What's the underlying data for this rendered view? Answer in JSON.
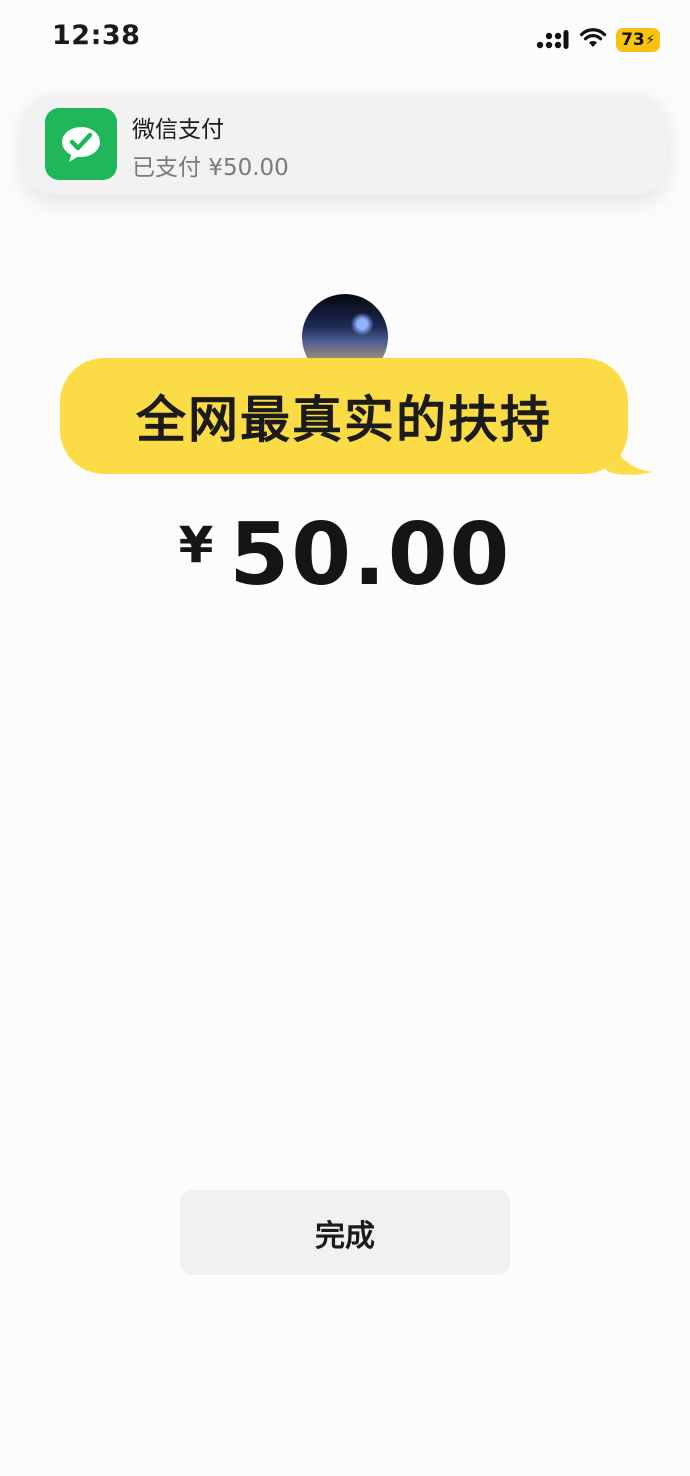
{
  "status_bar": {
    "time": "12:38",
    "battery_level": "73",
    "battery_color": "#f6c40f",
    "icons": [
      "signal-icon",
      "wifi-icon",
      "charging-bolt-icon"
    ]
  },
  "notification": {
    "app_name": "微信支付",
    "message": "已支付 ¥50.00",
    "app_icon": "wechat-pay-icon",
    "app_icon_color": "#20b75a"
  },
  "payee": {
    "avatar": "avatar"
  },
  "caption": {
    "text": "全网最真实的扶持",
    "bubble_color": "#fbdc46"
  },
  "payment": {
    "currency_symbol": "¥",
    "amount": "50.00"
  },
  "actions": {
    "done_label": "完成"
  }
}
